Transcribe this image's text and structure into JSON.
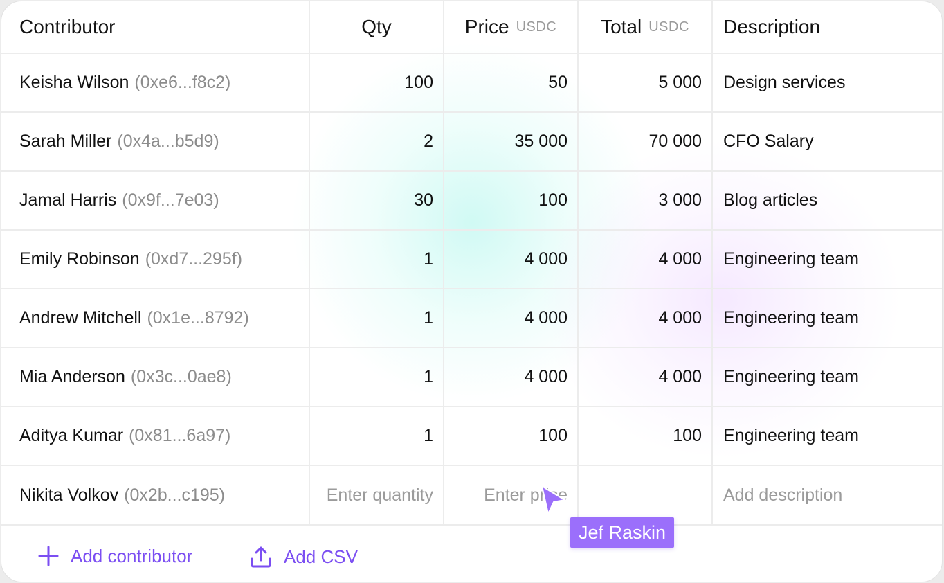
{
  "table": {
    "headers": {
      "contributor": "Contributor",
      "qty": "Qty",
      "price": "Price",
      "price_unit": "USDC",
      "total": "Total",
      "total_unit": "USDC",
      "description": "Description"
    },
    "rows": [
      {
        "name": "Keisha Wilson",
        "address": "(0xe6...f8c2)",
        "qty": "100",
        "price": "50",
        "total": "5 000",
        "description": "Design services"
      },
      {
        "name": "Sarah Miller",
        "address": "(0x4a...b5d9)",
        "qty": "2",
        "price": "35 000",
        "total": "70 000",
        "description": "CFO Salary"
      },
      {
        "name": "Jamal Harris",
        "address": "(0x9f...7e03)",
        "qty": "30",
        "price": "100",
        "total": "3 000",
        "description": "Blog articles"
      },
      {
        "name": "Emily Robinson",
        "address": "(0xd7...295f)",
        "qty": "1",
        "price": "4 000",
        "total": "4 000",
        "description": "Engineering  team"
      },
      {
        "name": "Andrew Mitchell",
        "address": "(0x1e...8792)",
        "qty": "1",
        "price": "4 000",
        "total": "4 000",
        "description": "Engineering  team"
      },
      {
        "name": "Mia Anderson",
        "address": "(0x3c...0ae8)",
        "qty": "1",
        "price": "4 000",
        "total": "4 000",
        "description": "Engineering  team"
      },
      {
        "name": "Aditya Kumar",
        "address": "(0x81...6a97)",
        "qty": "1",
        "price": "100",
        "total": "100",
        "description": "Engineering  team"
      }
    ],
    "new_row": {
      "name": "Nikita Volkov",
      "address": "(0x2b...c195)",
      "qty_placeholder": "Enter quantity",
      "price_placeholder": "Enter price",
      "description_placeholder": "Add description"
    }
  },
  "footer": {
    "add_contributor": "Add contributor",
    "add_csv": "Add CSV"
  },
  "collaborator_cursor": {
    "name": "Jef Raskin",
    "color": "#9b6ffb"
  },
  "colors": {
    "accent": "#7b4ef2",
    "muted_text": "#8c8c8c"
  }
}
